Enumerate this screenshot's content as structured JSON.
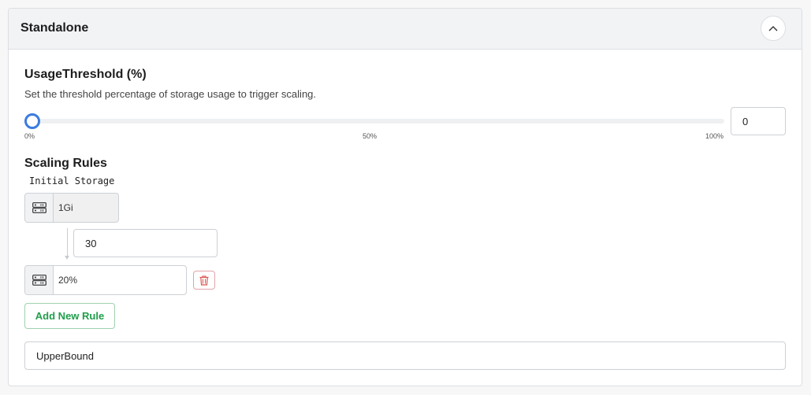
{
  "panel": {
    "title": "Standalone",
    "collapse_icon": "chevron-up-icon"
  },
  "usage_threshold": {
    "title": "UsageThreshold (%)",
    "description": "Set the threshold percentage of storage usage to trigger scaling.",
    "slider": {
      "value": 0,
      "min_label": "0%",
      "mid_label": "50%",
      "max_label": "100%"
    },
    "input_value": "0"
  },
  "scaling_rules": {
    "title": "Scaling Rules",
    "initial_storage_label": "Initial Storage",
    "initial_storage_value": "1Gi",
    "rule_threshold_value": "30",
    "rule_storage_value": "20%",
    "storage_icon": "server-icon",
    "delete_icon": "trash-icon",
    "add_rule_label": "Add New Rule"
  },
  "upper_bound": {
    "value": "UpperBound"
  },
  "colors": {
    "accent": "#3a7be0",
    "add_green": "#1f9e4a",
    "delete_red": "#d9534f"
  }
}
